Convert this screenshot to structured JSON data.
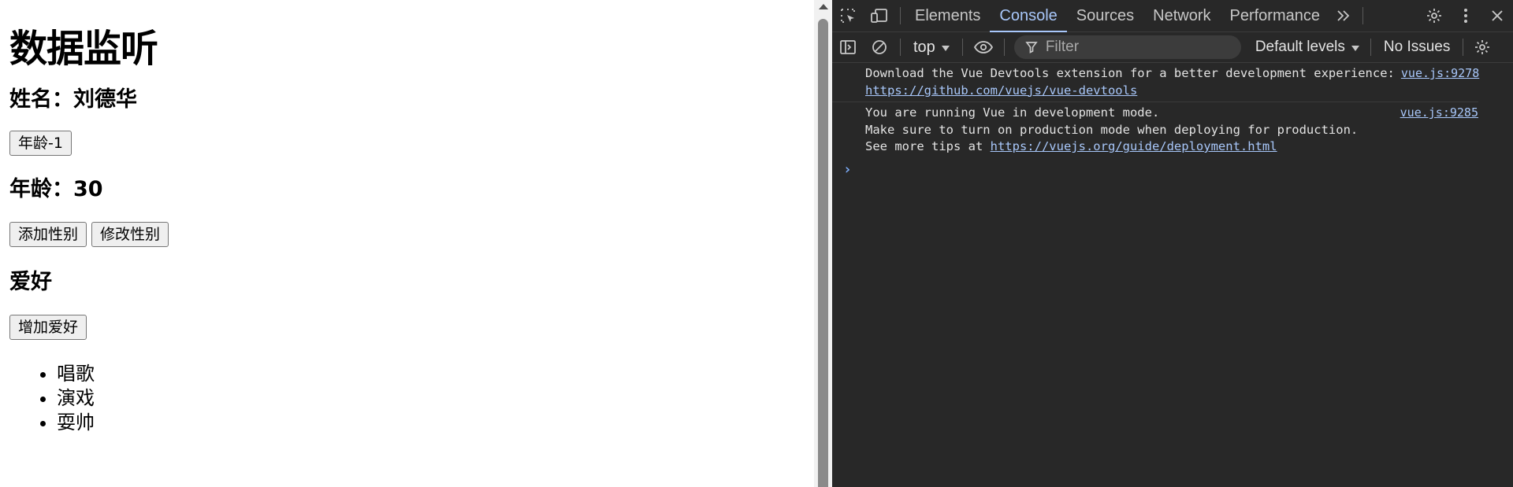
{
  "page": {
    "title": "数据监听",
    "name_label": "姓名：刘德华",
    "age_minus_button": "年龄-1",
    "age_label": "年龄：30",
    "add_gender_button": "添加性别",
    "edit_gender_button": "修改性别",
    "hobby_heading": "爱好",
    "add_hobby_button": "增加爱好",
    "hobbies": [
      "唱歌",
      "演戏",
      "耍帅"
    ]
  },
  "devtools": {
    "tabs": [
      {
        "label": "Elements"
      },
      {
        "label": "Console"
      },
      {
        "label": "Sources"
      },
      {
        "label": "Network"
      },
      {
        "label": "Performance"
      }
    ],
    "active_tab": "Console",
    "more_tabs_icon": "double-chevron-right-icon",
    "context": "top",
    "filter_placeholder": "Filter",
    "levels": "Default levels",
    "issues": "No Issues",
    "messages": [
      {
        "line1": "Download the Vue Devtools extension for a better development experience:",
        "link": "https://github.com/vuejs/vue-devtools",
        "source": "vue.js:9278"
      },
      {
        "line1": "You are running Vue in development mode.",
        "line2": "Make sure to turn on production mode when deploying for production.",
        "line3_prefix": "See more tips at ",
        "link": "https://vuejs.org/guide/deployment.html",
        "source": "vue.js:9285"
      }
    ],
    "prompt": "›"
  },
  "colors": {
    "devtools_bg": "#282828",
    "active_tab": "#a8c7fa",
    "link": "#a8c7fa",
    "text": "#e3e3e3"
  }
}
